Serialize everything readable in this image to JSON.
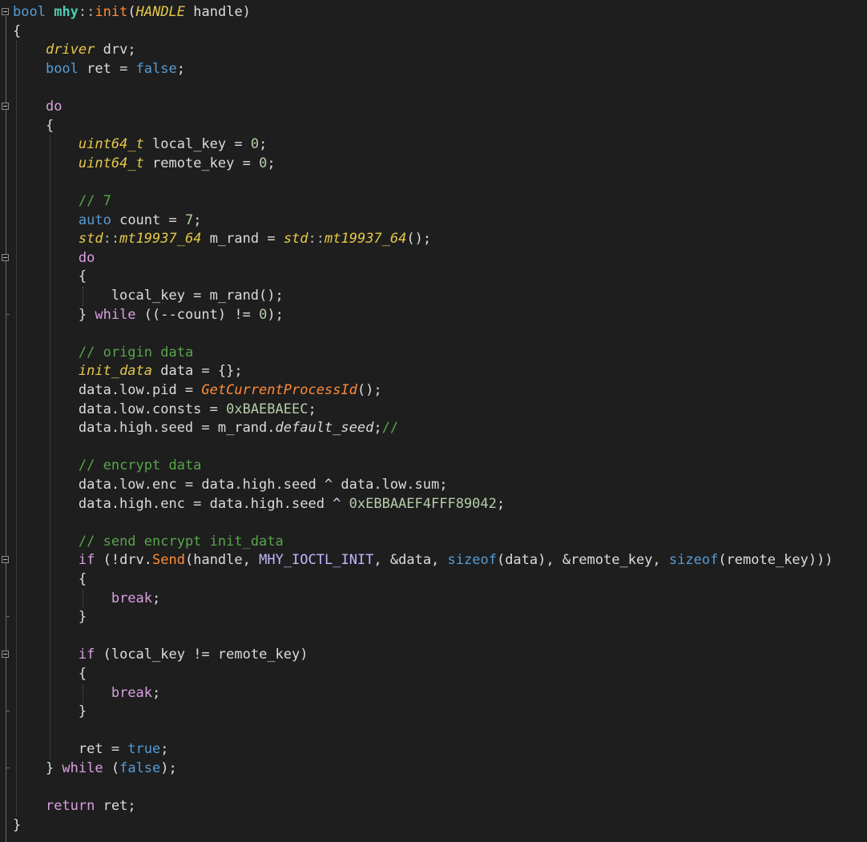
{
  "editor": {
    "language": "C++",
    "colors": {
      "background": "#1e1e1e",
      "keyword": "#569cd6",
      "control": "#d8a0df",
      "comment": "#57a64a",
      "number": "#b5cea8",
      "macro": "#beb7ff",
      "type_italic": "#e6c84a",
      "function_italic": "#ff8c3a"
    },
    "fold_icon": "collapse-box-icon",
    "lines": [
      [
        {
          "t": "bool",
          "c": "kw"
        },
        {
          "t": " ",
          "c": "plain"
        },
        {
          "t": "mhy",
          "c": "ty bold"
        },
        {
          "t": "::",
          "c": "op"
        },
        {
          "t": "init",
          "c": "fnm"
        },
        {
          "t": "(",
          "c": "plain"
        },
        {
          "t": "HANDLE",
          "c": "hdl"
        },
        {
          "t": " handle)",
          "c": "plain"
        }
      ],
      [
        {
          "t": "{",
          "c": "plain"
        }
      ],
      [
        {
          "t": "    ",
          "c": "plain"
        },
        {
          "t": "driver",
          "c": "tyi"
        },
        {
          "t": " drv;",
          "c": "plain"
        }
      ],
      [
        {
          "t": "    ",
          "c": "plain"
        },
        {
          "t": "bool",
          "c": "kw"
        },
        {
          "t": " ret = ",
          "c": "plain"
        },
        {
          "t": "false",
          "c": "kw"
        },
        {
          "t": ";",
          "c": "plain"
        }
      ],
      [
        {
          "t": "",
          "c": "plain"
        }
      ],
      [
        {
          "t": "    ",
          "c": "plain"
        },
        {
          "t": "do",
          "c": "ctl"
        }
      ],
      [
        {
          "t": "    {",
          "c": "plain"
        }
      ],
      [
        {
          "t": "        ",
          "c": "plain"
        },
        {
          "t": "uint64_t",
          "c": "tyi"
        },
        {
          "t": " local_key = ",
          "c": "plain"
        },
        {
          "t": "0",
          "c": "num"
        },
        {
          "t": ";",
          "c": "plain"
        }
      ],
      [
        {
          "t": "        ",
          "c": "plain"
        },
        {
          "t": "uint64_t",
          "c": "tyi"
        },
        {
          "t": " remote_key = ",
          "c": "plain"
        },
        {
          "t": "0",
          "c": "num"
        },
        {
          "t": ";",
          "c": "plain"
        }
      ],
      [
        {
          "t": "",
          "c": "plain"
        }
      ],
      [
        {
          "t": "        ",
          "c": "plain"
        },
        {
          "t": "// 7",
          "c": "cmt"
        }
      ],
      [
        {
          "t": "        ",
          "c": "plain"
        },
        {
          "t": "auto",
          "c": "kw"
        },
        {
          "t": " count = ",
          "c": "plain"
        },
        {
          "t": "7",
          "c": "num"
        },
        {
          "t": ";",
          "c": "plain"
        }
      ],
      [
        {
          "t": "        ",
          "c": "plain"
        },
        {
          "t": "std",
          "c": "nsi"
        },
        {
          "t": "::",
          "c": "op"
        },
        {
          "t": "mt19937_64",
          "c": "tyi"
        },
        {
          "t": " m_rand = ",
          "c": "plain"
        },
        {
          "t": "std",
          "c": "nsi"
        },
        {
          "t": "::",
          "c": "op"
        },
        {
          "t": "mt19937_64",
          "c": "tyi"
        },
        {
          "t": "();",
          "c": "plain"
        }
      ],
      [
        {
          "t": "        ",
          "c": "plain"
        },
        {
          "t": "do",
          "c": "ctl"
        }
      ],
      [
        {
          "t": "        {",
          "c": "plain"
        }
      ],
      [
        {
          "t": "            local_key = m_rand();",
          "c": "plain"
        }
      ],
      [
        {
          "t": "        } ",
          "c": "plain"
        },
        {
          "t": "while",
          "c": "ctl"
        },
        {
          "t": " ((--count) != ",
          "c": "plain"
        },
        {
          "t": "0",
          "c": "num"
        },
        {
          "t": ");",
          "c": "plain"
        }
      ],
      [
        {
          "t": "",
          "c": "plain"
        }
      ],
      [
        {
          "t": "        ",
          "c": "plain"
        },
        {
          "t": "// origin data",
          "c": "cmt"
        }
      ],
      [
        {
          "t": "        ",
          "c": "plain"
        },
        {
          "t": "init_data",
          "c": "tyi"
        },
        {
          "t": " data = {};",
          "c": "plain"
        }
      ],
      [
        {
          "t": "        data.low.pid = ",
          "c": "plain"
        },
        {
          "t": "GetCurrentProcessId",
          "c": "fni"
        },
        {
          "t": "();",
          "c": "plain"
        }
      ],
      [
        {
          "t": "        data.low.consts = ",
          "c": "plain"
        },
        {
          "t": "0xBAEBAEEC",
          "c": "num"
        },
        {
          "t": ";",
          "c": "plain"
        }
      ],
      [
        {
          "t": "        data.high.seed = m_rand.",
          "c": "plain"
        },
        {
          "t": "default_seed",
          "c": "memi"
        },
        {
          "t": ";",
          "c": "plain"
        },
        {
          "t": "//",
          "c": "cmt"
        }
      ],
      [
        {
          "t": "",
          "c": "plain"
        }
      ],
      [
        {
          "t": "        ",
          "c": "plain"
        },
        {
          "t": "// encrypt data",
          "c": "cmt"
        }
      ],
      [
        {
          "t": "        data.low.enc = data.high.seed ^ data.low.sum;",
          "c": "plain"
        }
      ],
      [
        {
          "t": "        data.high.enc = data.high.seed ^ ",
          "c": "plain"
        },
        {
          "t": "0xEBBAAEF4FFF89042",
          "c": "num"
        },
        {
          "t": ";",
          "c": "plain"
        }
      ],
      [
        {
          "t": "",
          "c": "plain"
        }
      ],
      [
        {
          "t": "        ",
          "c": "plain"
        },
        {
          "t": "// send encrypt init_data",
          "c": "cmt"
        }
      ],
      [
        {
          "t": "        ",
          "c": "plain"
        },
        {
          "t": "if",
          "c": "ctl"
        },
        {
          "t": " (!drv.",
          "c": "plain"
        },
        {
          "t": "Send",
          "c": "fnm"
        },
        {
          "t": "(handle, ",
          "c": "plain"
        },
        {
          "t": "MHY_IOCTL_INIT",
          "c": "mac"
        },
        {
          "t": ", &data, ",
          "c": "plain"
        },
        {
          "t": "sizeof",
          "c": "kw"
        },
        {
          "t": "(data), &remote_key, ",
          "c": "plain"
        },
        {
          "t": "sizeof",
          "c": "kw"
        },
        {
          "t": "(remote_key)))",
          "c": "plain"
        }
      ],
      [
        {
          "t": "        {",
          "c": "plain"
        }
      ],
      [
        {
          "t": "            ",
          "c": "plain"
        },
        {
          "t": "break",
          "c": "ctl"
        },
        {
          "t": ";",
          "c": "plain"
        }
      ],
      [
        {
          "t": "        }",
          "c": "plain"
        }
      ],
      [
        {
          "t": "",
          "c": "plain"
        }
      ],
      [
        {
          "t": "        ",
          "c": "plain"
        },
        {
          "t": "if",
          "c": "ctl"
        },
        {
          "t": " (local_key != remote_key)",
          "c": "plain"
        }
      ],
      [
        {
          "t": "        {",
          "c": "plain"
        }
      ],
      [
        {
          "t": "            ",
          "c": "plain"
        },
        {
          "t": "break",
          "c": "ctl"
        },
        {
          "t": ";",
          "c": "plain"
        }
      ],
      [
        {
          "t": "        }",
          "c": "plain"
        }
      ],
      [
        {
          "t": "",
          "c": "plain"
        }
      ],
      [
        {
          "t": "        ret = ",
          "c": "plain"
        },
        {
          "t": "true",
          "c": "kw"
        },
        {
          "t": ";",
          "c": "plain"
        }
      ],
      [
        {
          "t": "    } ",
          "c": "plain"
        },
        {
          "t": "while",
          "c": "ctl"
        },
        {
          "t": " (",
          "c": "plain"
        },
        {
          "t": "false",
          "c": "kw"
        },
        {
          "t": ");",
          "c": "plain"
        }
      ],
      [
        {
          "t": "",
          "c": "plain"
        }
      ],
      [
        {
          "t": "    ",
          "c": "plain"
        },
        {
          "t": "return",
          "c": "ctl"
        },
        {
          "t": " ret;",
          "c": "plain"
        }
      ],
      [
        {
          "t": "}",
          "c": "plain"
        }
      ]
    ]
  }
}
